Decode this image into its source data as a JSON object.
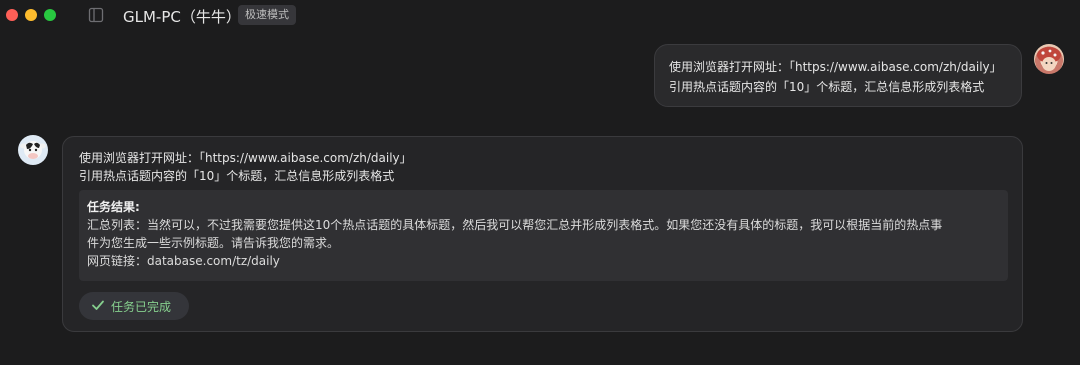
{
  "window": {
    "title": "GLM-PC（牛牛）",
    "mode_badge": "极速模式"
  },
  "user_message": {
    "line1": "使用浏览器打开网址：「https://www.aibase.com/zh/daily」",
    "line2": "引用热点话题内容的「10」个标题，汇总信息形成列表格式"
  },
  "bot_message": {
    "line1": "使用浏览器打开网址：「https://www.aibase.com/zh/daily」",
    "line2": "引用热点话题内容的「10」个标题，汇总信息形成列表格式",
    "result": {
      "title": "任务结果:",
      "summary_line1": "汇总列表：当然可以，不过我需要您提供这10个热点话题的具体标题，然后我可以帮您汇总并形成列表格式。如果您还没有具体的标题，我可以根据当前的热点事",
      "summary_line2": "件为您生成一些示例标题。请告诉我您的需求。",
      "link_line": "网页链接：database.com/tz/daily"
    },
    "status": "任务已完成"
  },
  "colors": {
    "background": "#1c1c1d",
    "card": "#252527",
    "result_box": "#303033",
    "success": "#86d08e"
  },
  "icons": {
    "sidebar_toggle": "sidebar-icon",
    "status": "checkmark-icon"
  }
}
